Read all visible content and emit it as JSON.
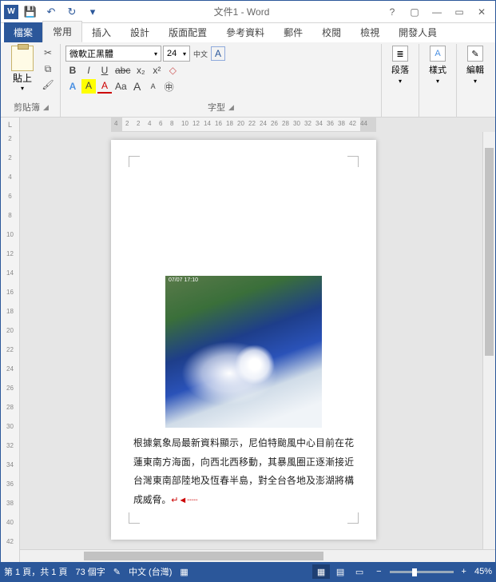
{
  "app": {
    "title": "文件1 - Word"
  },
  "qat": {
    "save": "💾",
    "undo": "↶",
    "redo": "↻",
    "more": "▾"
  },
  "winctrls": {
    "help": "?",
    "ribbonopts": "▢",
    "min": "—",
    "restore": "▭",
    "close": "✕"
  },
  "tabs": [
    "檔案",
    "常用",
    "插入",
    "設計",
    "版面配置",
    "參考資料",
    "郵件",
    "校閱",
    "檢視",
    "開發人員"
  ],
  "active_tab": 1,
  "ribbon": {
    "clipboard": {
      "paste": "貼上",
      "label": "剪貼簿"
    },
    "font": {
      "name": "微軟正黑體",
      "size": "24",
      "label": "字型",
      "grow": "A▴",
      "shrink": "A▾",
      "phonetic": "中文",
      "box": "A",
      "bold": "B",
      "italic": "I",
      "underline": "U",
      "strike": "abc",
      "sub": "x₂",
      "sup": "x²",
      "effects": "A",
      "highlight": "A",
      "color": "A",
      "case": "Aa",
      "big": "A",
      "small": "A",
      "clear": "◇",
      "circled": "㊥"
    },
    "paragraph": {
      "label": "段落"
    },
    "styles": {
      "label": "樣式"
    },
    "editing": {
      "label": "編輯"
    }
  },
  "hruler_ticks": [
    "4",
    "2",
    "2",
    "4",
    "6",
    "8",
    "10",
    "12",
    "14",
    "16",
    "18",
    "20",
    "22",
    "24",
    "26",
    "28",
    "30",
    "32",
    "34",
    "36",
    "38",
    "42",
    "44"
  ],
  "vruler_ticks": [
    "2",
    "2",
    "4",
    "6",
    "8",
    "10",
    "12",
    "14",
    "16",
    "18",
    "20",
    "22",
    "24",
    "26",
    "28",
    "30",
    "32",
    "34",
    "36",
    "38",
    "40",
    "42"
  ],
  "document": {
    "image_timestamp": "07/07 17:10",
    "body": "根據氣象局最新資料顯示，尼伯特颱風中心目前在花蓮東南方海面，向西北西移動，其暴風圈正逐漸接近台灣東南部陸地及恆春半島，對全台各地及澎湖將構成威脅。",
    "end_mark": "↵◄┈┈"
  },
  "statusbar": {
    "page": "第 1 頁，共 1 頁",
    "words": "73 個字",
    "proof": "✎",
    "lang": "中文 (台灣)",
    "macro": "▦",
    "zoom": "45%"
  }
}
